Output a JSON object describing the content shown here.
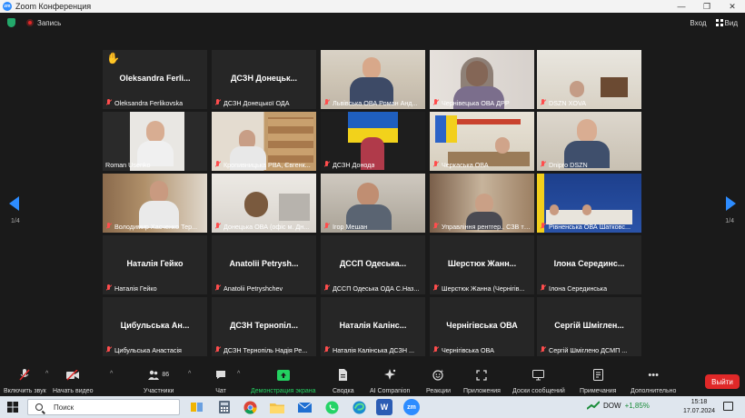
{
  "window": {
    "title": "Zoom Конференция",
    "controls": [
      "—",
      "❐",
      "✕"
    ]
  },
  "topbar": {
    "recording_label": "Запись",
    "login_label": "Вход",
    "view_label": "Вид"
  },
  "gallery": {
    "page_left": "1/4",
    "page_right": "1/4",
    "tiles": [
      {
        "center": "Oleksandra Ferli...",
        "label": "Oleksandra Ferlikovska",
        "hand": true
      },
      {
        "center": "ДСЗН Донецьк...",
        "label": "ДСЗН Донецької ОДА"
      },
      {
        "center": "",
        "label": "Львівська ОВА Роман Анд..."
      },
      {
        "center": "",
        "label": "Чернівецька ОВА ДРР"
      },
      {
        "center": "",
        "label": "DSZN XOVA"
      },
      {
        "center": "",
        "label": "Roman Usenko",
        "active": true
      },
      {
        "center": "",
        "label": "Кропивницька РВА, Євгенк..."
      },
      {
        "center": "",
        "label": "ДСЗН Донода"
      },
      {
        "center": "",
        "label": "Черкаська ОВА"
      },
      {
        "center": "",
        "label": "Dnipro DSZN"
      },
      {
        "center": "",
        "label": "Володимир Хасченко Тер..."
      },
      {
        "center": "",
        "label": "Донецька ОВА (офіс м. Дн..."
      },
      {
        "center": "",
        "label": "Ігор Мешан"
      },
      {
        "center": "",
        "label": "Управління рентгер.. СЗВ та ..."
      },
      {
        "center": "",
        "label": "Рівненська ОВА Шатковс..."
      },
      {
        "center": "Наталія Гейко",
        "label": "Наталія Гейко"
      },
      {
        "center": "Anatolii Petrysh...",
        "label": "Anatolii Petryshchev"
      },
      {
        "center": "ДССП Одеська...",
        "label": "ДССП Одеська ОДА С.Наз..."
      },
      {
        "center": "Шерстюк Жанн...",
        "label": "Шерстюк Жанна (Чернігів..."
      },
      {
        "center": "Ілона Серединс...",
        "label": "Ілона Серединська"
      },
      {
        "center": "Цибульська Ан...",
        "label": "Цибульська Анастасія"
      },
      {
        "center": "ДСЗН Тернопіл...",
        "label": "ДСЗН Тернопіль Надія Ре..."
      },
      {
        "center": "Наталія Калінс...",
        "label": "Наталія Калінська ДСЗН ..."
      },
      {
        "center": "Чернігівська ОВА",
        "label": "Чернігівська ОВА"
      },
      {
        "center": "Сергій Шміглен...",
        "label": "Сергій Шміглено ДСМП ..."
      }
    ]
  },
  "toolbar": {
    "unmute": "Включить звук",
    "video": "Начать видео",
    "participants": "Участники",
    "participants_count": "86",
    "chat": "Чат",
    "share": "Демонстрация экрана",
    "summary": "Сводка",
    "companion": "AI Companion",
    "reactions": "Реакции",
    "apps": "Приложения",
    "whiteboards": "Доски сообщений",
    "notes": "Примечания",
    "more": "Дополнительно",
    "end": "Выйти",
    "accent_green": "#23d160",
    "end_color": "#e02828"
  },
  "taskbar": {
    "search_placeholder": "Поиск",
    "ticker_name": "DOW",
    "ticker_change": "+1,85%",
    "time": "15:18",
    "date": "17.07.2024"
  }
}
